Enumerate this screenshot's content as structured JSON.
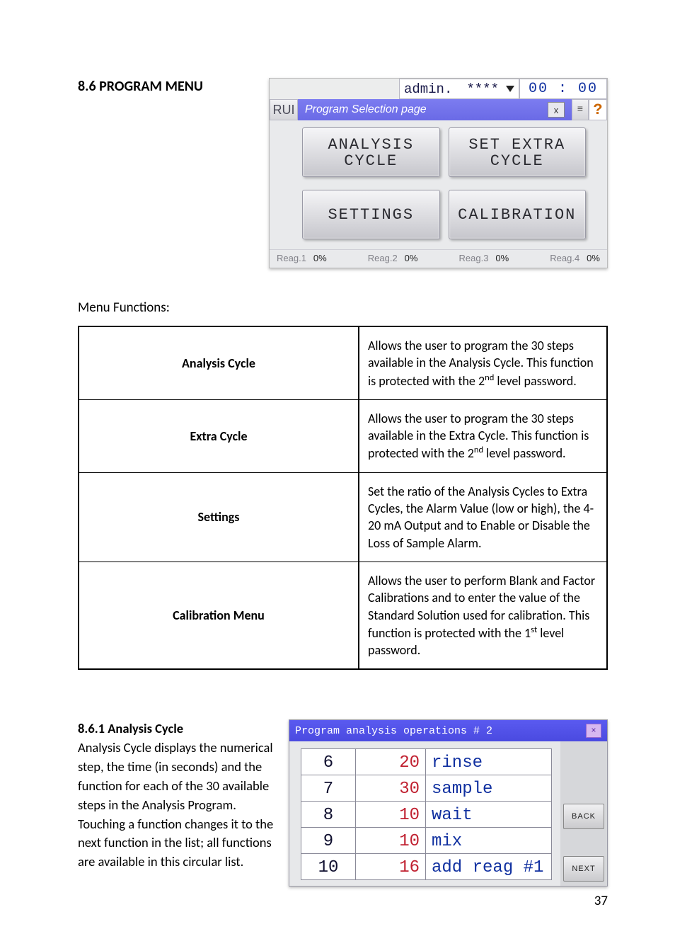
{
  "section_heading": "8.6 PROGRAM MENU",
  "hmi1": {
    "user_label": "admin.",
    "user_mask": "****",
    "clock": "00 : 00",
    "run_label": "RUI",
    "title": "Program Selection page",
    "close_label": "x",
    "help_label": "?",
    "buttons": {
      "analysis_l1": "ANALYSIS",
      "analysis_l2": "CYCLE",
      "extra_l1": "SET EXTRA",
      "extra_l2": "CYCLE",
      "settings": "SETTINGS",
      "calibration": "CALIBRATION"
    },
    "status": [
      {
        "label": "Reag.1",
        "val": "0%"
      },
      {
        "label": "Reag.2",
        "val": "0%"
      },
      {
        "label": "Reag.3",
        "val": "0%"
      },
      {
        "label": "Reag.4",
        "val": "0%"
      }
    ]
  },
  "menu_functions_label": "Menu Functions:",
  "menu_functions": [
    {
      "name": "Analysis Cycle",
      "desc_pre": "Allows the user to program the 30 steps available in the Analysis Cycle. This function is protected with the 2",
      "desc_sup": "nd",
      "desc_post": " level password."
    },
    {
      "name": "Extra Cycle",
      "desc_pre": "Allows the user to program the 30 steps available in the Extra Cycle. This function is protected with the 2",
      "desc_sup": "nd",
      "desc_post": " level password."
    },
    {
      "name": "Settings",
      "desc_pre": "Set the ratio of the Analysis Cycles to Extra Cycles, the Alarm Value (low or high), the 4-20 mA Output and to Enable or Disable the Loss of Sample Alarm.",
      "desc_sup": "",
      "desc_post": ""
    },
    {
      "name": "Calibration Menu",
      "desc_pre": "Allows the user to perform Blank and Factor Calibrations and to enter the value of the Standard Solution used for calibration. This function is protected with the 1",
      "desc_sup": "st",
      "desc_post": " level password."
    }
  ],
  "sub_heading": "8.6.1 Analysis Cycle",
  "sub_text": "Analysis Cycle displays the numerical step, the time (in seconds) and the function for each of the 30 available steps in the Analysis Program. Touching a function changes it to the next function in the list; all functions are available in this circular list.",
  "hmi2": {
    "title": "Program analysis operations # 2",
    "close": "×",
    "back": "BACK",
    "next": "NEXT",
    "rows": [
      {
        "n": "6",
        "t": "20",
        "f": "rinse"
      },
      {
        "n": "7",
        "t": "30",
        "f": "sample"
      },
      {
        "n": "8",
        "t": "10",
        "f": "wait"
      },
      {
        "n": "9",
        "t": "10",
        "f": "mix"
      },
      {
        "n": "10",
        "t": "16",
        "f": "add reag #1"
      }
    ]
  },
  "page_number": "37"
}
